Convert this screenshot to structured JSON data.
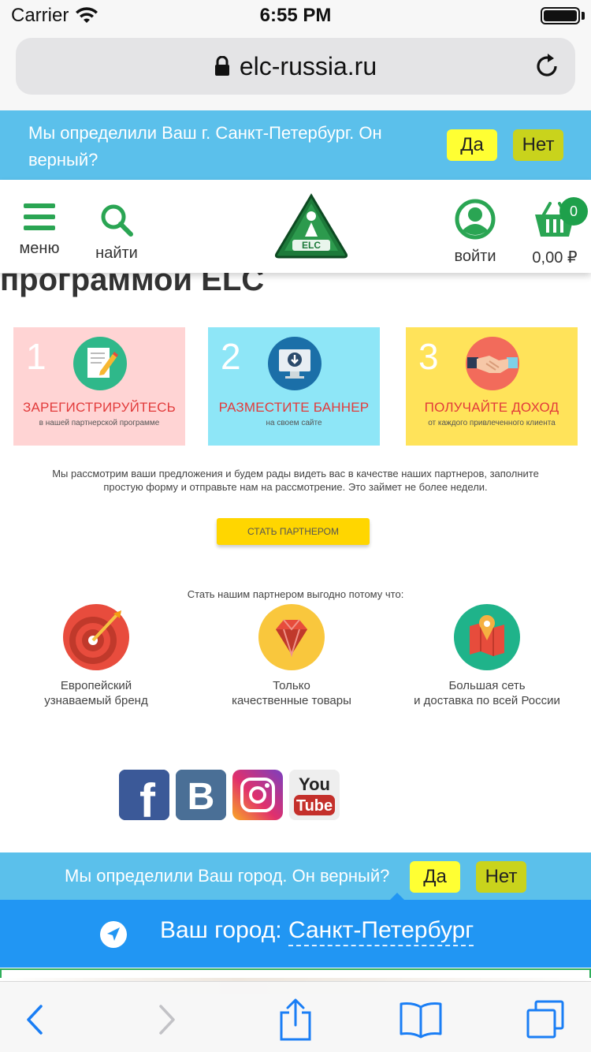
{
  "status_bar": {
    "carrier": "Carrier",
    "time": "6:55 PM"
  },
  "browser": {
    "url": "elc-russia.ru"
  },
  "city_prompt_top": {
    "text": "Мы определили Ваш г. Санкт-Петербург. Он верный?",
    "yes": "Да",
    "no": "Нет"
  },
  "header": {
    "menu_label": "меню",
    "search_label": "найти",
    "login_label": "войти",
    "cart_count": "0",
    "cart_total": "0,00 ₽",
    "logo_text": "ELC"
  },
  "page": {
    "heading": "программой ELC"
  },
  "steps": [
    {
      "number": "1",
      "title": "ЗАРЕГИСТРИРУЙТЕСЬ",
      "subtitle": "в нашей партнерской программе"
    },
    {
      "number": "2",
      "title": "РАЗМЕСТИТЕ БАННЕР",
      "subtitle": "на своем сайте"
    },
    {
      "number": "3",
      "title": "ПОЛУЧАЙТЕ ДОХОД",
      "subtitle": "от каждого привлеченного клиента"
    }
  ],
  "intro": "Мы рассмотрим ваши предложения и будем рады видеть вас в качестве наших партнеров, заполните простую форму и отправьте нам на рассмотрение. Это займет не более недели.",
  "partner_button": "СТАТЬ ПАРТНЕРОМ",
  "benefits": {
    "title": "Стать нашим партнером выгодно потому что:",
    "items": [
      {
        "line1": "Европейский",
        "line2": "узнаваемый бренд"
      },
      {
        "line1": "Только",
        "line2": "качественные товары"
      },
      {
        "line1": "Большая сеть",
        "line2": "и доставка по всей России"
      }
    ]
  },
  "social": {
    "facebook": "f",
    "vk": "B",
    "youtube_top": "You",
    "youtube_bottom": "Tube"
  },
  "city_prompt_bottom": {
    "text": "Мы определили Ваш город. Он верный?",
    "yes": "Да",
    "no": "Нет"
  },
  "city_select": {
    "label": "Ваш город:",
    "value": "Санкт-Петербург"
  },
  "colors": {
    "banner": "#5bc0eb",
    "accent_green": "#1ea04b",
    "city_blue": "#2196f3",
    "card1": "#ffd4d4",
    "card2": "#8ee6f7",
    "card3": "#ffe35a"
  }
}
